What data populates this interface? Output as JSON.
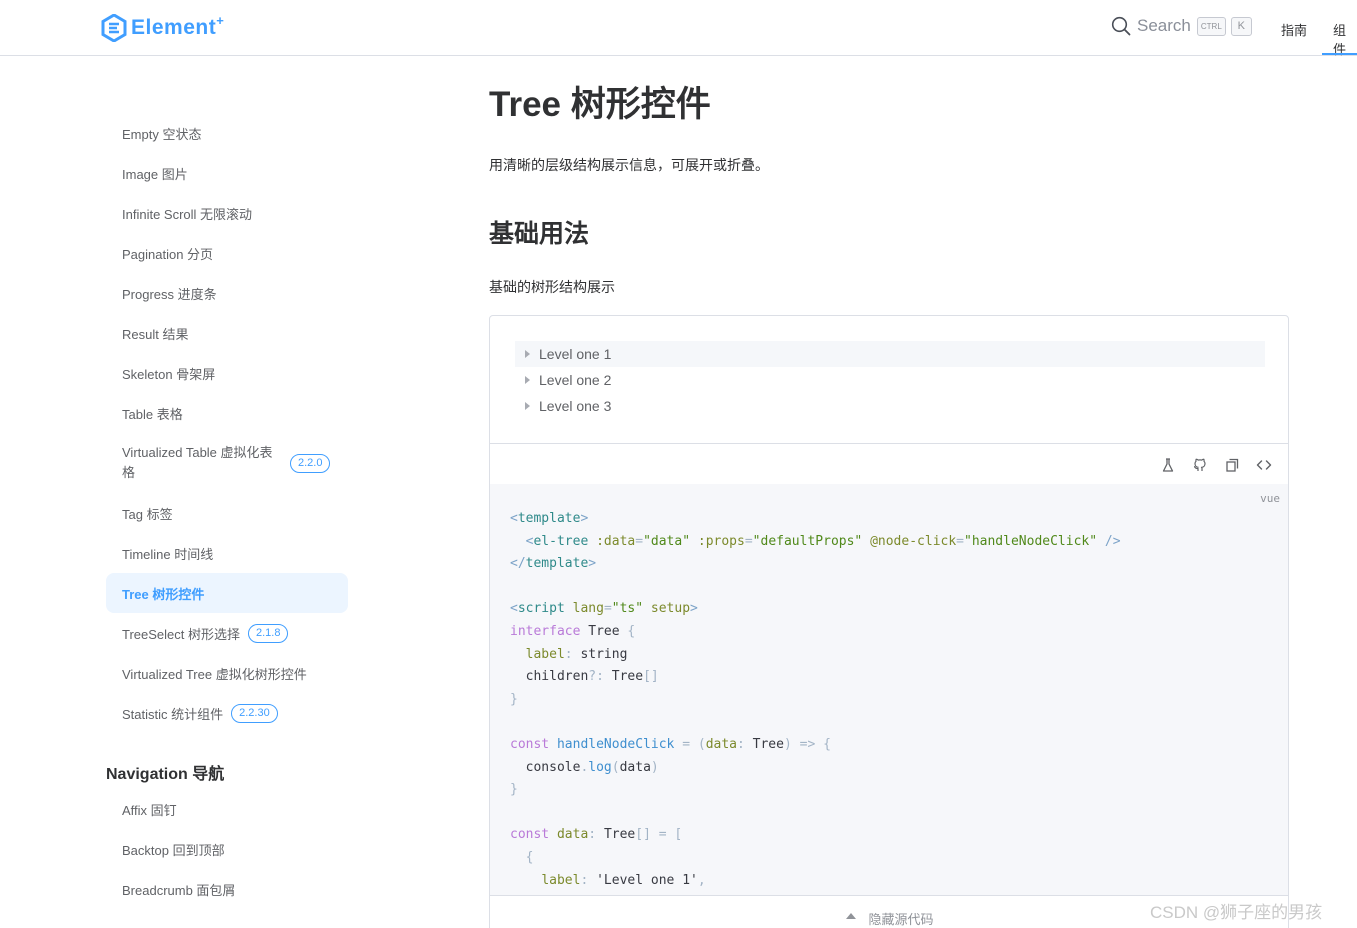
{
  "header": {
    "logo_text": "Element",
    "logo_sup": "+",
    "search_label": "Search",
    "kbd_ctrl": "CTRL",
    "kbd_k": "K",
    "nav": [
      "指南",
      "组件"
    ]
  },
  "sidebar": {
    "items": [
      {
        "label": "Empty 空状态"
      },
      {
        "label": "Image 图片"
      },
      {
        "label": "Infinite Scroll 无限滚动"
      },
      {
        "label": "Pagination 分页"
      },
      {
        "label": "Progress 进度条"
      },
      {
        "label": "Result 结果"
      },
      {
        "label": "Skeleton 骨架屏"
      },
      {
        "label": "Table 表格"
      },
      {
        "label": "Virtualized Table 虚拟化表格",
        "badge": "2.2.0"
      },
      {
        "label": "Tag 标签"
      },
      {
        "label": "Timeline 时间线"
      },
      {
        "label": "Tree 树形控件",
        "active": true
      },
      {
        "label": "TreeSelect 树形选择",
        "badge": "2.1.8"
      },
      {
        "label": "Virtualized Tree 虚拟化树形控件"
      },
      {
        "label": "Statistic 统计组件",
        "badge": "2.2.30"
      }
    ],
    "group_title": "Navigation 导航",
    "group_items": [
      {
        "label": "Affix 固钉"
      },
      {
        "label": "Backtop 回到顶部"
      },
      {
        "label": "Breadcrumb 面包屑"
      }
    ]
  },
  "main": {
    "title": "Tree 树形控件",
    "description": "用清晰的层级结构展示信息，可展开或折叠。",
    "section_title": "基础用法",
    "section_desc": "基础的树形结构展示",
    "tree_nodes": [
      "Level one 1",
      "Level one 2",
      "Level one 3"
    ],
    "code_lang": "vue",
    "hide_code_label": "隐藏源代码"
  },
  "icons": [
    "search-icon",
    "playground-icon",
    "github-icon",
    "copy-icon",
    "code-icon",
    "caret-right-icon",
    "caret-up-icon"
  ],
  "colors": {
    "accent": "#409eff",
    "active_bg": "#ecf5ff"
  },
  "watermark": "CSDN @狮子座的男孩"
}
